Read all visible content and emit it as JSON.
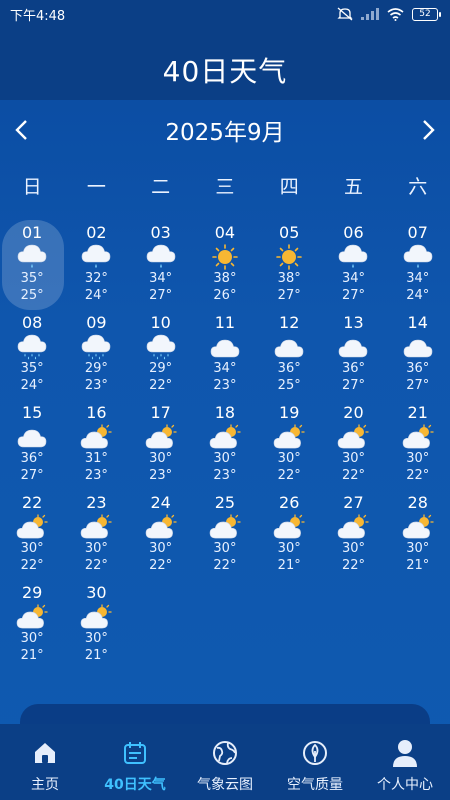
{
  "status": {
    "time": "下午4:48",
    "battery": "52"
  },
  "header": {
    "title": "40日天气"
  },
  "calendar": {
    "month_label": "2025年9月",
    "weekdays": [
      "日",
      "一",
      "二",
      "三",
      "四",
      "五",
      "六"
    ],
    "start_offset": 0,
    "selected_day": "01",
    "days": [
      {
        "day": "01",
        "icon": "light-rain",
        "high": "35°",
        "low": "25°"
      },
      {
        "day": "02",
        "icon": "light-rain",
        "high": "32°",
        "low": "24°"
      },
      {
        "day": "03",
        "icon": "light-rain",
        "high": "34°",
        "low": "27°"
      },
      {
        "day": "04",
        "icon": "sunny",
        "high": "38°",
        "low": "26°"
      },
      {
        "day": "05",
        "icon": "sunny",
        "high": "38°",
        "low": "27°"
      },
      {
        "day": "06",
        "icon": "light-rain",
        "high": "34°",
        "low": "27°"
      },
      {
        "day": "07",
        "icon": "light-rain",
        "high": "34°",
        "low": "24°"
      },
      {
        "day": "08",
        "icon": "heavy-rain",
        "high": "35°",
        "low": "24°"
      },
      {
        "day": "09",
        "icon": "heavy-rain",
        "high": "29°",
        "low": "23°"
      },
      {
        "day": "10",
        "icon": "heavy-rain",
        "high": "29°",
        "low": "22°"
      },
      {
        "day": "11",
        "icon": "cloudy",
        "high": "34°",
        "low": "23°"
      },
      {
        "day": "12",
        "icon": "cloudy",
        "high": "36°",
        "low": "25°"
      },
      {
        "day": "13",
        "icon": "cloudy",
        "high": "36°",
        "low": "27°"
      },
      {
        "day": "14",
        "icon": "cloudy",
        "high": "36°",
        "low": "27°"
      },
      {
        "day": "15",
        "icon": "cloudy",
        "high": "36°",
        "low": "27°"
      },
      {
        "day": "16",
        "icon": "partly-cloudy",
        "high": "31°",
        "low": "23°"
      },
      {
        "day": "17",
        "icon": "partly-cloudy",
        "high": "30°",
        "low": "23°"
      },
      {
        "day": "18",
        "icon": "partly-cloudy",
        "high": "30°",
        "low": "23°"
      },
      {
        "day": "19",
        "icon": "partly-cloudy",
        "high": "30°",
        "low": "22°"
      },
      {
        "day": "20",
        "icon": "partly-cloudy",
        "high": "30°",
        "low": "22°"
      },
      {
        "day": "21",
        "icon": "partly-cloudy",
        "high": "30°",
        "low": "22°"
      },
      {
        "day": "22",
        "icon": "partly-cloudy",
        "high": "30°",
        "low": "22°"
      },
      {
        "day": "23",
        "icon": "partly-cloudy",
        "high": "30°",
        "low": "22°"
      },
      {
        "day": "24",
        "icon": "partly-cloudy",
        "high": "30°",
        "low": "22°"
      },
      {
        "day": "25",
        "icon": "partly-cloudy",
        "high": "30°",
        "low": "22°"
      },
      {
        "day": "26",
        "icon": "partly-cloudy",
        "high": "30°",
        "low": "21°"
      },
      {
        "day": "27",
        "icon": "partly-cloudy",
        "high": "30°",
        "low": "22°"
      },
      {
        "day": "28",
        "icon": "partly-cloudy",
        "high": "30°",
        "low": "21°"
      },
      {
        "day": "29",
        "icon": "partly-cloudy",
        "high": "30°",
        "low": "21°"
      },
      {
        "day": "30",
        "icon": "partly-cloudy",
        "high": "30°",
        "low": "21°"
      }
    ]
  },
  "tabbar": {
    "active": "40日天气",
    "tabs": [
      {
        "label": "主页",
        "icon": "home-icon"
      },
      {
        "label": "40日天气",
        "icon": "calendar-icon"
      },
      {
        "label": "气象云图",
        "icon": "globe-icon"
      },
      {
        "label": "空气质量",
        "icon": "leaf-icon"
      },
      {
        "label": "个人中心",
        "icon": "user-icon"
      }
    ]
  },
  "colors": {
    "background": "#0f56ad",
    "header": "#0b3f86",
    "active_tab": "#3fc1ff",
    "sun": "#f7b733",
    "rain": "#7fd3ff"
  }
}
